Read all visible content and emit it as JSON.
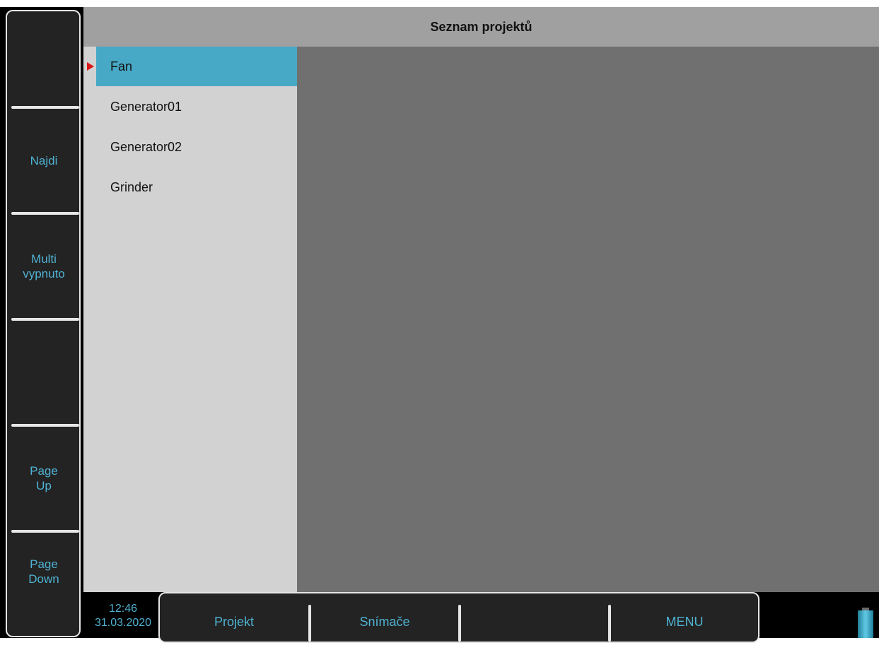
{
  "title": "Seznam projektů",
  "left_keys": [
    "",
    "Najdi",
    "Multi\nvypnuto",
    "",
    "Page\nUp",
    "Page\nDown"
  ],
  "projects": [
    "Fan",
    "Generator01",
    "Generator02",
    "Grinder"
  ],
  "selected_project": "Fan",
  "clock": {
    "time": "12:46",
    "date": "31.03.2020"
  },
  "function_keys": [
    "Projekt",
    "Snímače",
    "",
    "MENU"
  ],
  "colors": {
    "accent": "#4fb2d2",
    "selection": "#48a9c6",
    "selection_arrow": "#d81818",
    "header_bg": "#a0a0a0",
    "list_bg": "#d2d2d2",
    "detail_bg": "#707070"
  },
  "icons": {
    "selection_marker": "triangle-right-icon",
    "battery": "battery-icon"
  },
  "battery_level": 1.0
}
